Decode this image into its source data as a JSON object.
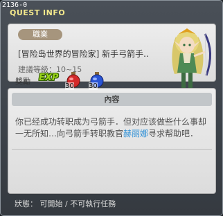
{
  "window": {
    "quest_code": "2136-0",
    "title": "QUEST INFO"
  },
  "summary": {
    "job_badge": "職業",
    "quest_name": "[冒险岛世界的冒险家] 新手弓箭手..",
    "level_label": "建議等級：",
    "level_range": "10~15"
  },
  "content": {
    "header": "內容",
    "text_part1": "你已经成功转职成为弓箭手．但对应该做些什么事却一无所知…向弓箭手转职教官",
    "npc_name": "赫丽娜",
    "text_part2": "寻求帮助吧．"
  },
  "reward": {
    "label": "獎勵",
    "exp_label": "EXP",
    "items": [
      {
        "icon": "red-potion-icon",
        "quantity": "30",
        "color": "#d42a2a"
      },
      {
        "icon": "blue-potion-icon",
        "quantity": "30",
        "color": "#2a55d4"
      }
    ]
  },
  "status": {
    "text": "狀態： 可開始 / 不可執行任務"
  },
  "colors": {
    "title": "#f4e98c",
    "npc_highlight": "#2c8fd6",
    "badge": "#a6957d"
  }
}
